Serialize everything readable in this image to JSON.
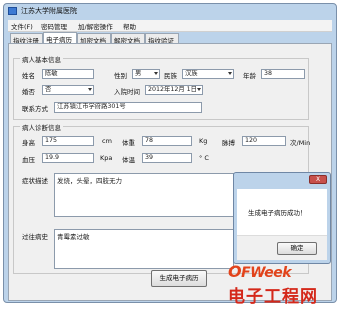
{
  "window": {
    "title": "江苏大学附属医院"
  },
  "menu": [
    {
      "label": "文件(F)"
    },
    {
      "label": "密码管理"
    },
    {
      "label": "加/解密操作"
    },
    {
      "label": "帮助"
    }
  ],
  "tabs": [
    {
      "label": "指纹注册",
      "active": false
    },
    {
      "label": "电子病历",
      "active": true
    },
    {
      "label": "加密文档",
      "active": false
    },
    {
      "label": "解密文档",
      "active": false
    },
    {
      "label": "指纹验证",
      "active": false
    }
  ],
  "basic": {
    "group_title": "病人基本信息",
    "name_label": "姓名",
    "name_value": "陈敏",
    "sex_label": "性别",
    "sex_value": "男",
    "ethnic_label": "民族",
    "ethnic_value": "汉族",
    "age_label": "年龄",
    "age_value": "38",
    "marriage_label": "婚否",
    "marriage_value": "否",
    "admit_label": "入院时间",
    "admit_value": "2012年12月 1日",
    "contact_label": "联系方式",
    "contact_value": "江苏镇江市学府路301号"
  },
  "diag": {
    "group_title": "病人诊断信息",
    "height_label": "身高",
    "height_value": "175",
    "height_unit": "cm",
    "weight_label": "体重",
    "weight_value": "78",
    "weight_unit": "Kg",
    "pulse_label": "脉搏",
    "pulse_value": "120",
    "pulse_unit": "次/Min",
    "bp_label": "血压",
    "bp_value": "19.9",
    "bp_unit": "Kpa",
    "temp_label": "体温",
    "temp_value": "39",
    "temp_unit": "° C",
    "symptom_label": "症状描述",
    "symptom_value": "发烧，头晕，四肢无力",
    "history_label": "过往病史",
    "history_value": "青霉素过敏"
  },
  "generate_button": "生成电子病历",
  "dialog": {
    "close_label": "X",
    "message": "生成电子病历成功！",
    "ok_button": "确定"
  },
  "watermark": {
    "logo_o": "O",
    "logo_rest": "FWeek",
    "sub": "电子工程网"
  }
}
